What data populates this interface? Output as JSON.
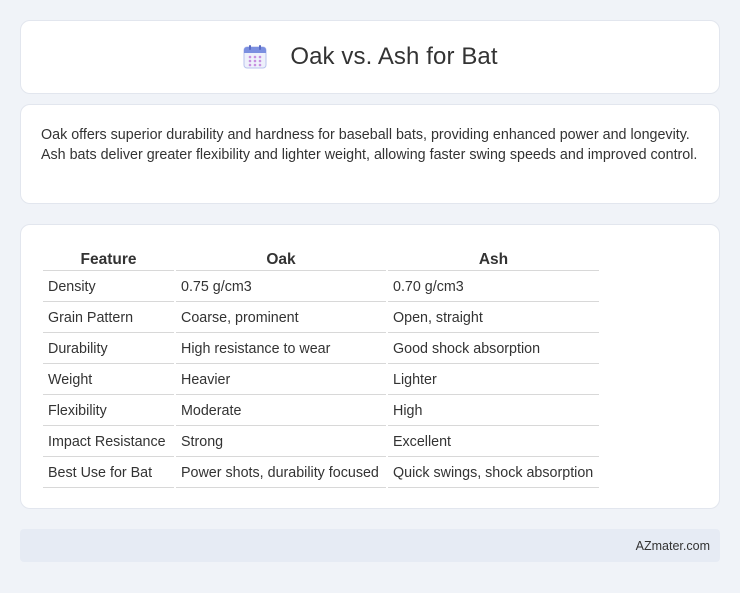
{
  "header": {
    "icon": "calendar-icon",
    "title": "Oak vs. Ash for Bat"
  },
  "summary": {
    "text": "Oak offers superior durability and hardness for baseball bats, providing enhanced power and longevity. Ash bats deliver greater flexibility and lighter weight, allowing faster swing speeds and improved control."
  },
  "table": {
    "headers": [
      "Feature",
      "Oak",
      "Ash"
    ],
    "rows": [
      [
        "Density",
        "0.75 g/cm3",
        "0.70 g/cm3"
      ],
      [
        "Grain Pattern",
        "Coarse, prominent",
        "Open, straight"
      ],
      [
        "Durability",
        "High resistance to wear",
        "Good shock absorption"
      ],
      [
        "Weight",
        "Heavier",
        "Lighter"
      ],
      [
        "Flexibility",
        "Moderate",
        "High"
      ],
      [
        "Impact Resistance",
        "Strong",
        "Excellent"
      ],
      [
        "Best Use for Bat",
        "Power shots, durability focused",
        "Quick swings, shock absorption"
      ]
    ]
  },
  "footer": {
    "text": "AZmater.com"
  },
  "colors": {
    "background": "#f0f3f8",
    "card": "#ffffff",
    "footer_bg": "#e6ebf4",
    "icon_accent": "#7b8fe0"
  }
}
